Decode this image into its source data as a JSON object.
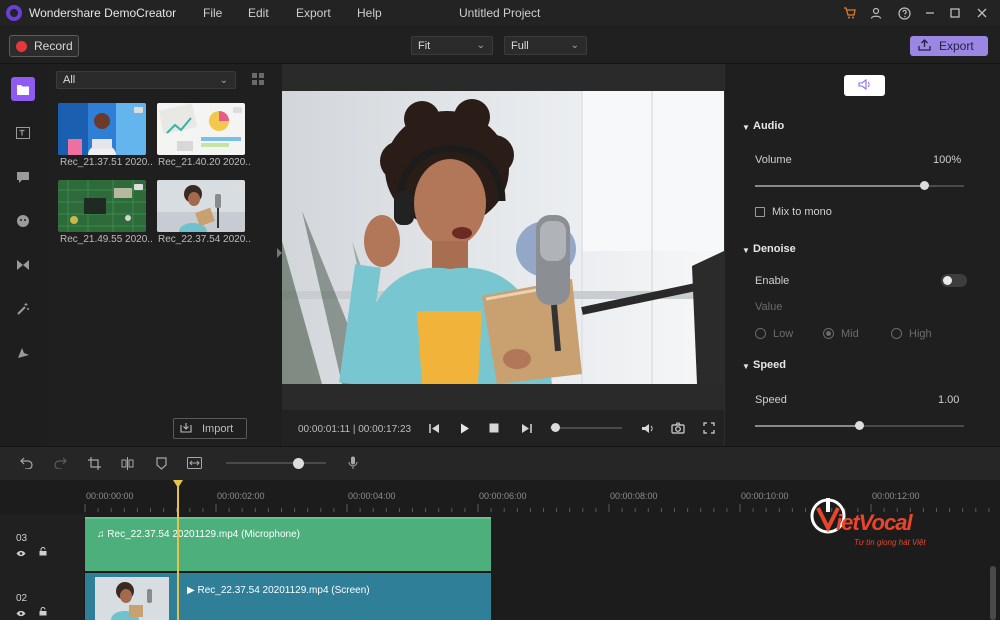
{
  "titlebar": {
    "app_name": "Wondershare DemoCreator",
    "menu": [
      "File",
      "Edit",
      "Export",
      "Help"
    ],
    "project_title": "Untitled Project",
    "icons": [
      "cart-icon",
      "user-icon",
      "help-icon",
      "minimize-icon",
      "maximize-icon",
      "close-icon"
    ]
  },
  "toolbar": {
    "record_label": "Record",
    "fit_value": "Fit",
    "quality_value": "Full",
    "export_label": "Export"
  },
  "left_rail": {
    "icons": [
      "folder-icon",
      "text-icon",
      "comment-icon",
      "sticker-icon",
      "transition-icon",
      "magic-wand-icon",
      "cursor-effect-icon"
    ]
  },
  "media": {
    "filter_value": "All",
    "items": [
      {
        "label": "Rec_21.37.51 2020..."
      },
      {
        "label": "Rec_21.40.20 2020..."
      },
      {
        "label": "Rec_21.49.55 2020..."
      },
      {
        "label": "Rec_22.37.54 2020..."
      }
    ],
    "import_label": "Import"
  },
  "preview": {
    "timecode": "00:00:01:11 | 00:00:17:23",
    "progress_fraction": 0.07
  },
  "properties": {
    "audio_title": "Audio",
    "volume_label": "Volume",
    "volume_value": "100%",
    "volume_fraction": 0.81,
    "mono_label": "Mix to mono",
    "denoise_title": "Denoise",
    "enable_label": "Enable",
    "value_label": "Value",
    "denoise_options": [
      "Low",
      "Mid",
      "High"
    ],
    "denoise_selected": "Mid",
    "speed_title": "Speed",
    "speed_label": "Speed",
    "speed_value": "1.00",
    "speed_fraction": 0.5
  },
  "timeline": {
    "ruler": [
      "00:00:00:00",
      "00:00:02:00",
      "00:00:04:00",
      "00:00:06:00",
      "00:00:08:00",
      "00:00:10:00",
      "00:00:12:00"
    ],
    "tracks": [
      {
        "num": "03",
        "clip_label": "Rec_22.37.54 20201129.mp4 (Microphone)"
      },
      {
        "num": "02",
        "clip_label": "Rec_22.37.54 20201129.mp4 (Screen)"
      }
    ],
    "tools": [
      "undo-icon",
      "redo-icon",
      "crop-icon",
      "split-icon",
      "marker-icon",
      "fit-icon",
      "microphone-icon"
    ],
    "zoom_fraction": 0.72
  },
  "watermark": {
    "brand": "ietVocal",
    "tagline": "Tư tin giọng hát Việt"
  },
  "colors": {
    "accent": "#8f5bf0",
    "export": "#9b87e3",
    "audio_clip": "#4caf7c",
    "screen_clip": "#2e7f97",
    "playhead": "#e8c14a",
    "record": "#e23a3a"
  }
}
